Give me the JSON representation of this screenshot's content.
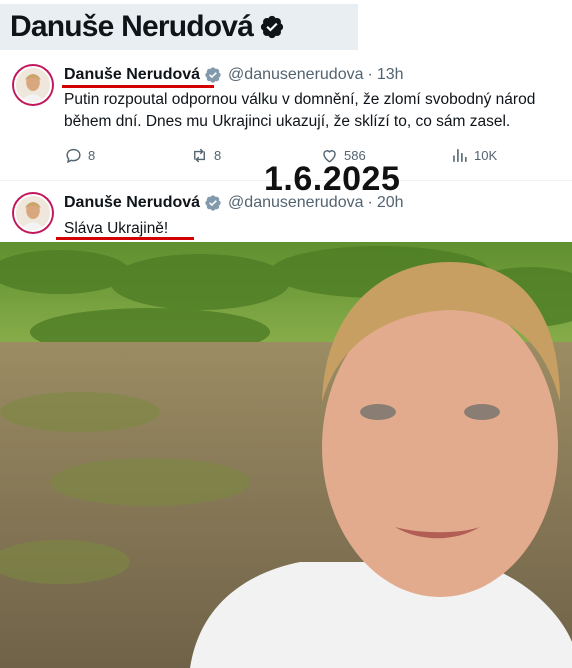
{
  "banner": {
    "name": "Danuše Nerudová"
  },
  "date_stamp": "1.6.2025",
  "tweets": [
    {
      "author": "Danuše Nerudová",
      "handle": "@danusenerudova",
      "separator": "·",
      "time": "13h",
      "text_lines": [
        "Putin rozpoutal odpornou válku v domnění, že zlomí svobodný národ",
        "během dní. Dnes mu Ukrajinci ukazují, že sklízí to, co sám zasel."
      ],
      "actions": {
        "replies": "8",
        "reposts": "8",
        "likes": "586",
        "views": "10K"
      }
    },
    {
      "author": "Danuše Nerudová",
      "handle": "@danusenerudova",
      "separator": "·",
      "time": "20h",
      "text_lines": [
        "Sláva Ukrajině!"
      ]
    }
  ],
  "colors": {
    "verified": "#829aab",
    "avatar_ring": "#c2185b",
    "underline": "#d40000",
    "muted": "#536471"
  },
  "icons": [
    "verified-badge-icon",
    "reply-icon",
    "repost-icon",
    "like-icon",
    "views-icon"
  ]
}
